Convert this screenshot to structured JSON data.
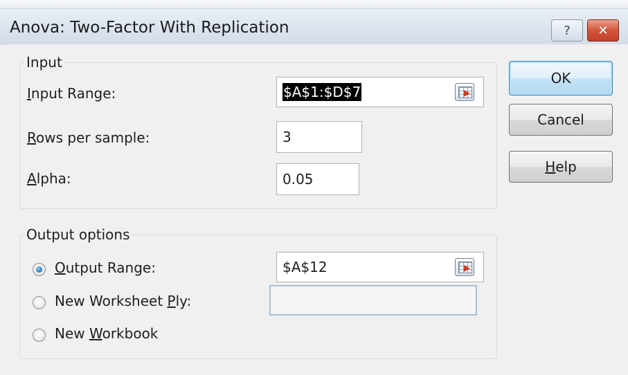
{
  "window": {
    "title": "Anova: Two-Factor With Replication",
    "help_glyph": "?",
    "close_glyph": "✕"
  },
  "input_group": {
    "title": "Input",
    "input_range": {
      "label_mnemonic": "I",
      "label_rest": "nput Range:",
      "value": "$A$1:$D$7"
    },
    "rows_per_sample": {
      "label_mnemonic": "R",
      "label_rest": "ows per sample:",
      "value": "3"
    },
    "alpha": {
      "label_mnemonic": "A",
      "label_rest": "lpha:",
      "value": "0.05"
    }
  },
  "output_group": {
    "title": "Output options",
    "output_range": {
      "label_mnemonic": "O",
      "label_rest": "utput Range:",
      "value": "$A$12",
      "checked": true
    },
    "new_worksheet": {
      "label_pre": "New Worksheet ",
      "label_mnemonic": "P",
      "label_rest": "ly:",
      "value": ""
    },
    "new_workbook": {
      "label_pre": "New ",
      "label_mnemonic": "W",
      "label_rest": "orkbook"
    }
  },
  "buttons": {
    "ok": "OK",
    "cancel": "Cancel",
    "help_mnemonic": "H",
    "help_rest": "elp"
  },
  "colors": {
    "close_button": "#c2412a",
    "default_button_border": "#3c7fb1",
    "radio_selected": "#2a7fbf"
  },
  "icons": {
    "range_selector": "collapse-dialog-icon"
  }
}
